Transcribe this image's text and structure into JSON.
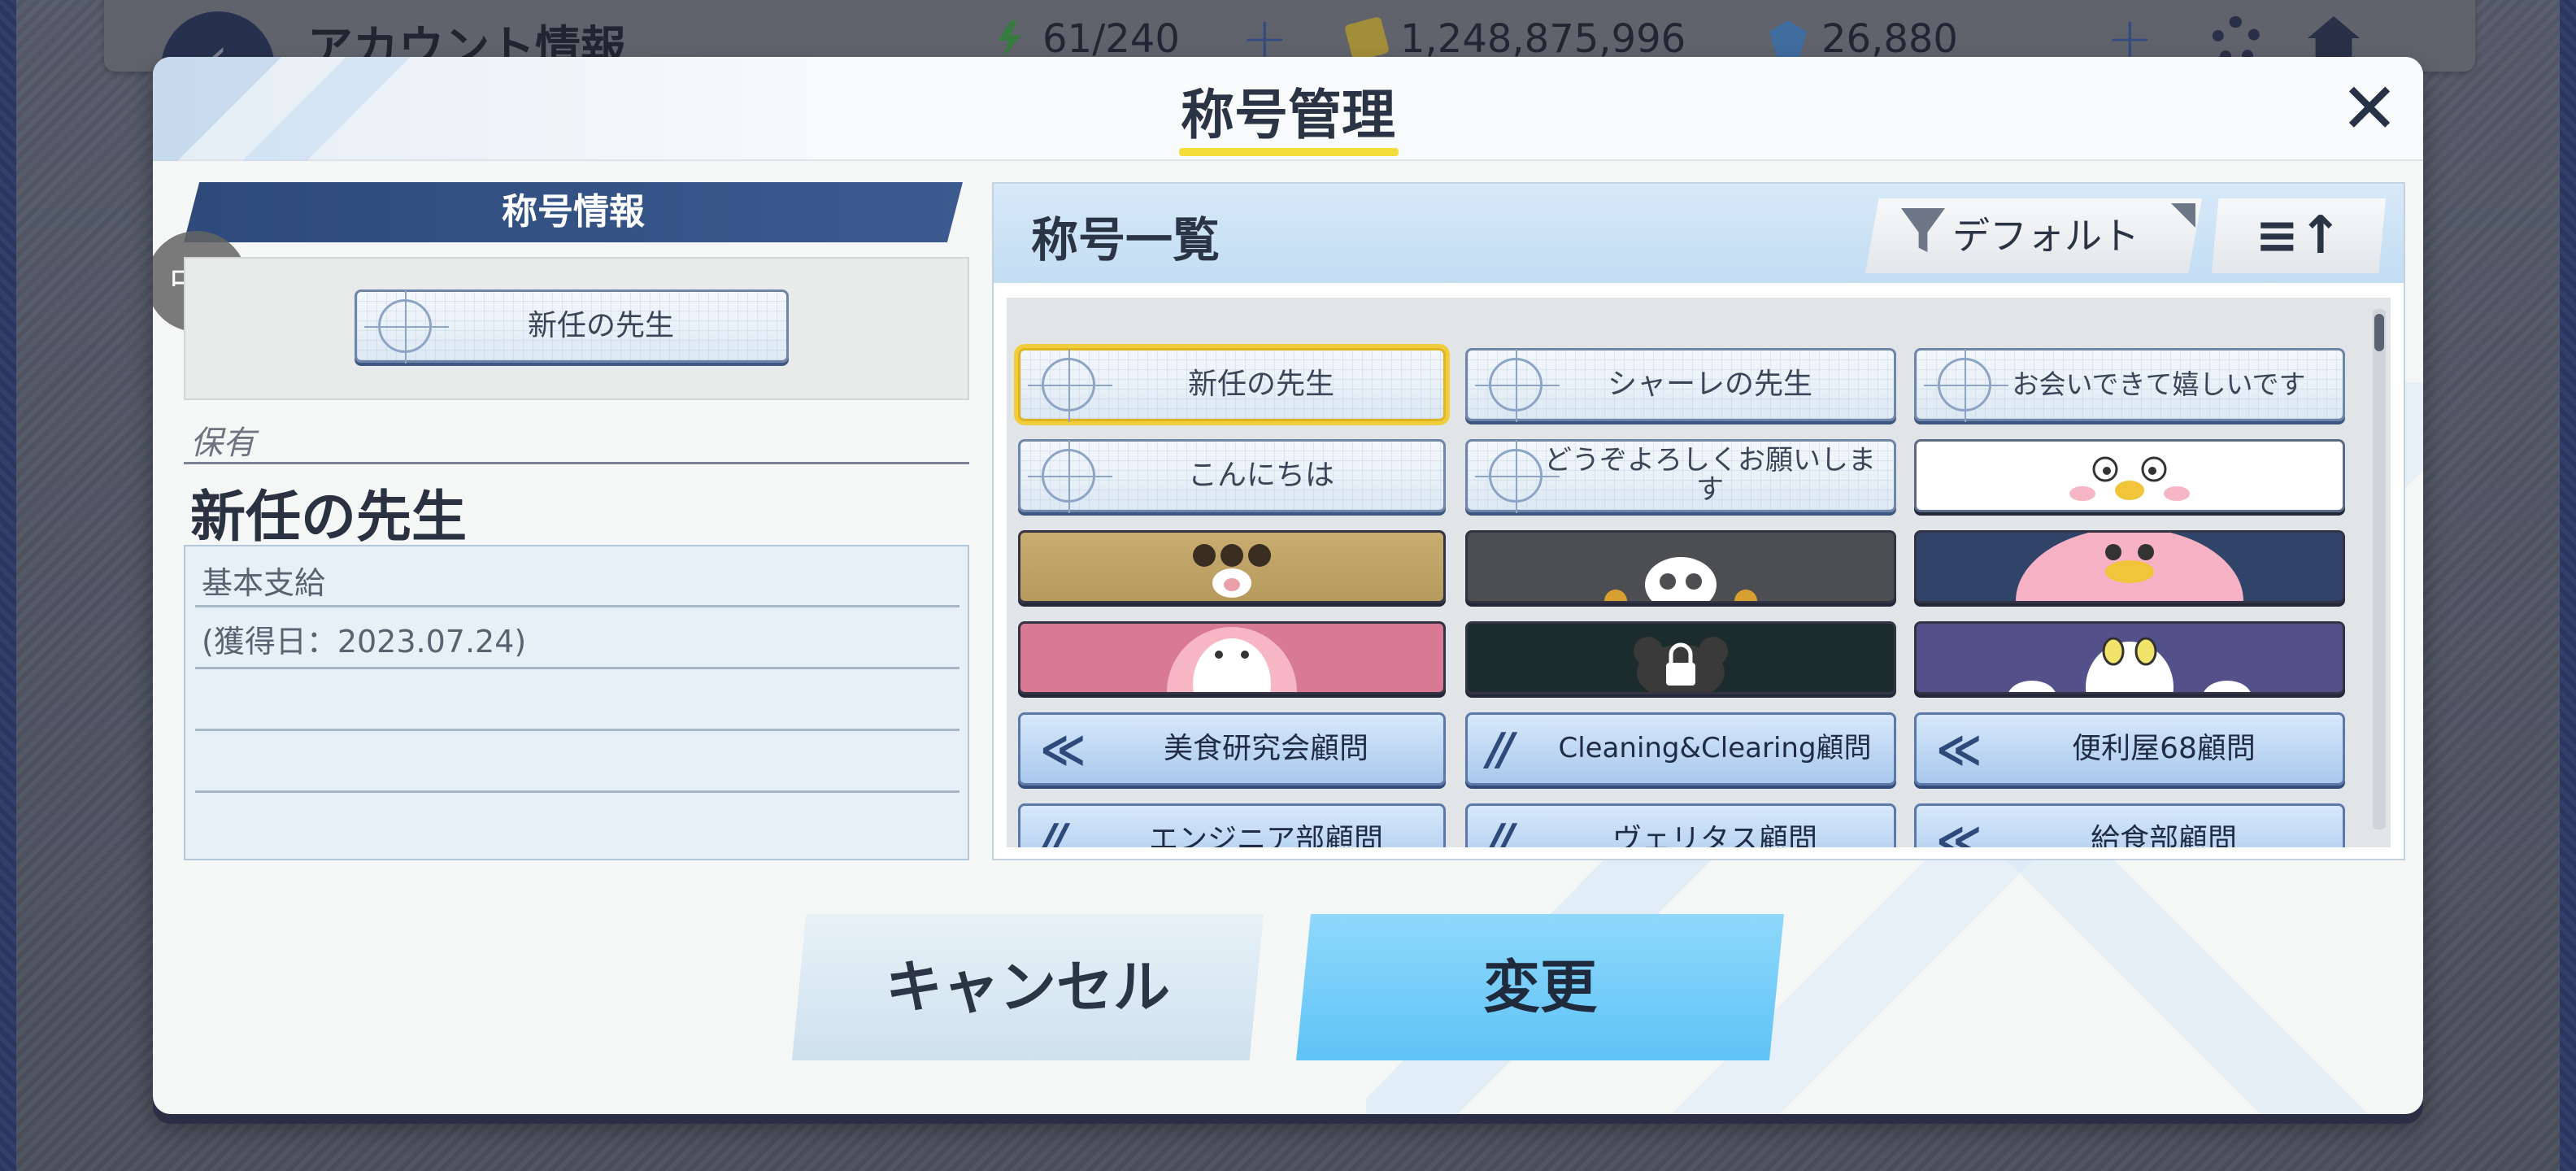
{
  "topbar": {
    "title": "アカウント情報",
    "ap": "61/240",
    "credits": "1,248,875,996",
    "gems": "26,880"
  },
  "modal": {
    "title": "称号管理",
    "close_icon": "close-icon"
  },
  "info": {
    "header": "称号情報",
    "translate_icon": "translate-icon",
    "selected_title": "新任の先生",
    "owned_label": "保有",
    "owned_name": "新任の先生",
    "desc_line1": "基本支給",
    "desc_line2": "(獲得日：2023.07.24)"
  },
  "list": {
    "header": "称号一覧",
    "filter_label": "デフォルト",
    "sort_icon": "sort-ascending-icon",
    "rows": [
      [
        "新任の先生",
        "シャーレの先生",
        "お会いできて嬉しいです"
      ],
      [
        "こんにちは",
        "どうぞよろしくお願いします",
        ""
      ],
      [
        "",
        "",
        ""
      ],
      [
        "",
        "",
        ""
      ],
      [
        "美食研究会顧問",
        "Cleaning&Clearing顧問",
        "便利屋68顧問"
      ],
      [
        "エンジニア部顧問",
        "ヴェリタス顧問",
        "給食部顧問"
      ]
    ],
    "colors": {
      "accent_yellow": "#f2cd3b",
      "plate_border": "#6f86a8",
      "change_button": "#5fc3f6"
    }
  },
  "buttons": {
    "cancel": "キャンセル",
    "change": "変更"
  }
}
